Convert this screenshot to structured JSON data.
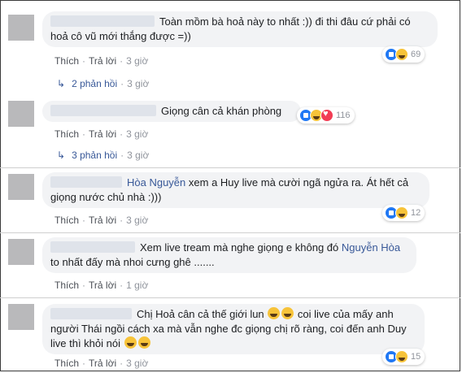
{
  "labels": {
    "like": "Thích",
    "reply": "Trả lời",
    "dot": "·"
  },
  "comments": [
    {
      "text": "Toàn mồm bà hoả này to nhất :)) đi thi đâu cứ phải có hoả cô vũ mới thắng được =))",
      "time": "3 giờ",
      "reaction_count": "69",
      "reaction_icons": [
        "like-icon",
        "haha-icon"
      ],
      "replies": {
        "label": "2 phản hồi",
        "time": "3 giờ"
      }
    },
    {
      "text": "Giọng cân cả khán phòng",
      "time": "3 giờ",
      "reaction_count": "116",
      "reaction_icons": [
        "like-icon",
        "haha-icon",
        "love-icon"
      ],
      "replies": {
        "label": "3 phản hồi",
        "time": "3 giờ"
      }
    },
    {
      "tag": "Hòa Nguyễn",
      "text": " xem a Huy live mà cười ngã ngửa ra. Át hết cả giọng nước chủ nhà :)))",
      "time": "3 giờ",
      "reaction_count": "12",
      "reaction_icons": [
        "like-icon",
        "haha-icon"
      ]
    },
    {
      "text_before": "Xem live tream mà nghe giọng e không đó ",
      "tag": "Nguyễn Hòa",
      "text_after": " to nhất đấy mà nhoi cưng ghê .......",
      "time": "1 giờ"
    },
    {
      "text_a": "Chị Hoả cân cả thế giới lun ",
      "text_b": " coi live của mấy anh người Thái ngồi cách xa mà vẫn nghe đc giọng chị rõ ràng, coi đến anh Duy live thì khỏi nói ",
      "time": "3 giờ",
      "reaction_count": "15",
      "reaction_icons": [
        "like-icon",
        "haha-icon"
      ]
    }
  ],
  "colors": {
    "link": "#385898",
    "bubble": "#f2f3f5",
    "meta": "#90949c"
  }
}
